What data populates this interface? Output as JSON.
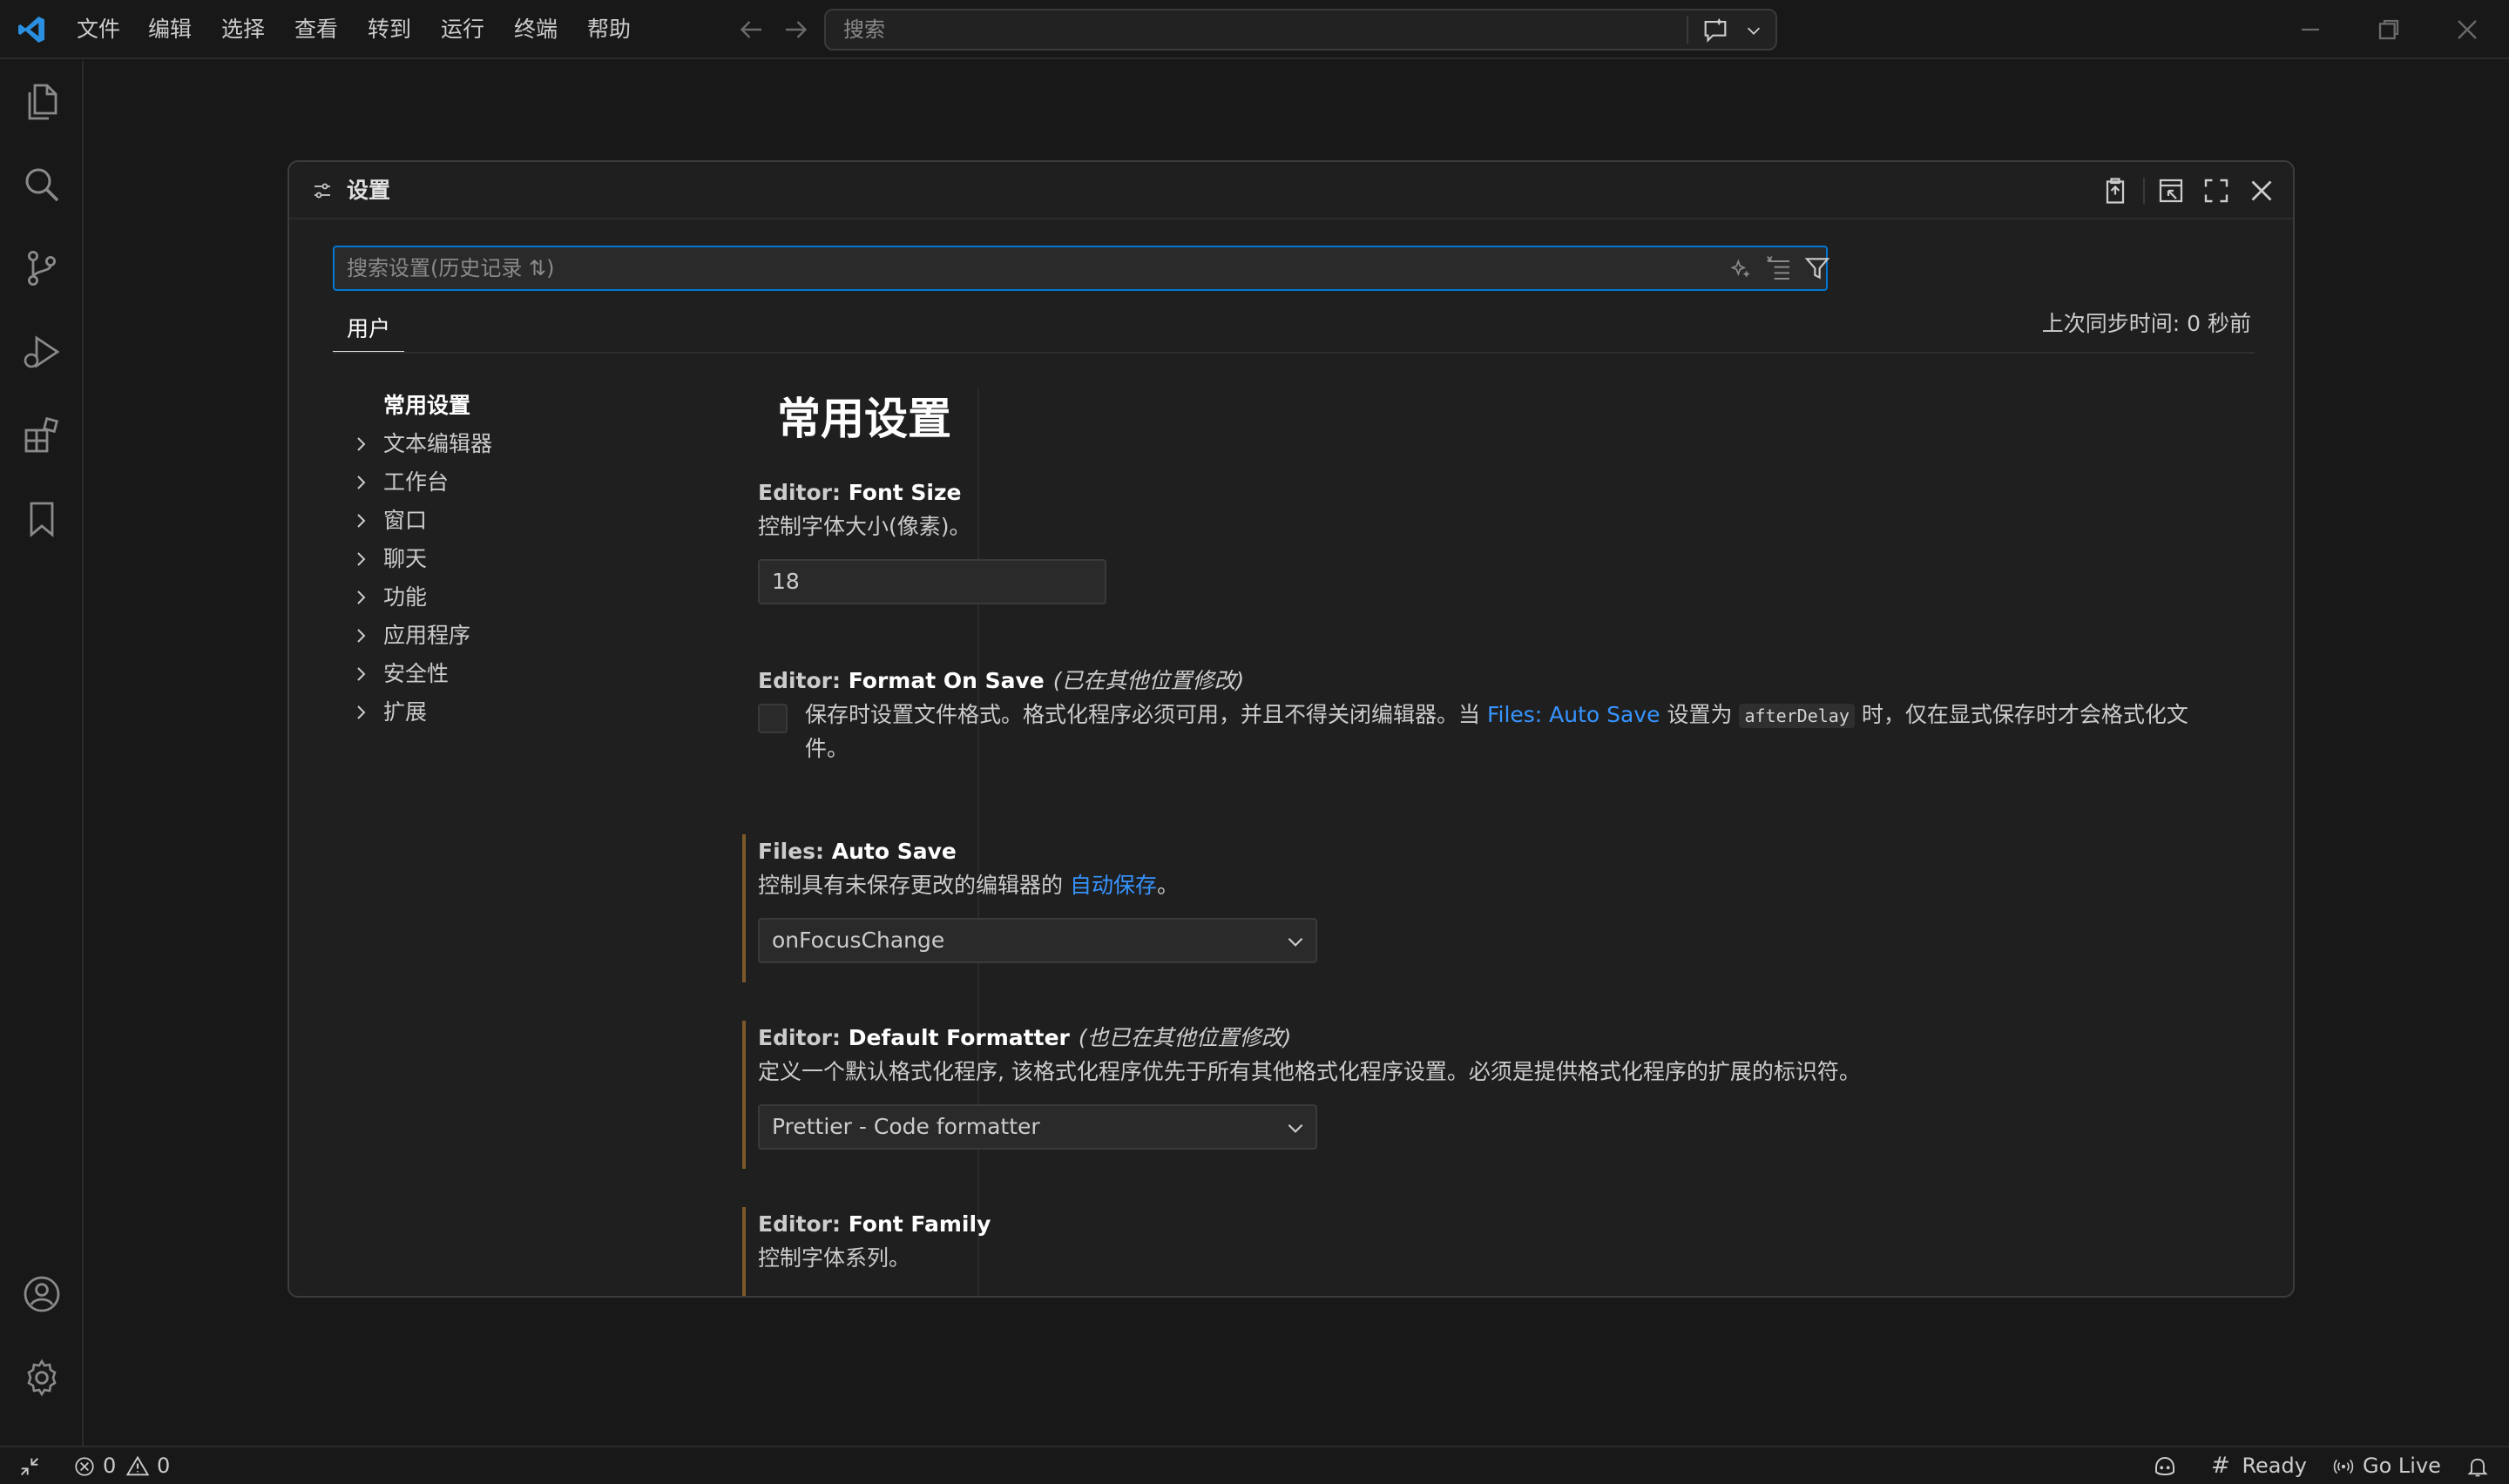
{
  "menu": [
    "文件",
    "编辑",
    "选择",
    "查看",
    "转到",
    "运行",
    "终端",
    "帮助"
  ],
  "command_center": {
    "placeholder": "搜索"
  },
  "settings": {
    "title": "设置",
    "search_placeholder": "搜索设置(历史记录 ⇅)",
    "tab_user": "用户",
    "sync_time": "上次同步时间: 0 秒前",
    "toc": [
      {
        "label": "常用设置",
        "active": true
      },
      {
        "label": "文本编辑器"
      },
      {
        "label": "工作台"
      },
      {
        "label": "窗口"
      },
      {
        "label": "聊天"
      },
      {
        "label": "功能"
      },
      {
        "label": "应用程序"
      },
      {
        "label": "安全性"
      },
      {
        "label": "扩展"
      }
    ],
    "section_title": "常用设置",
    "font_size": {
      "category": "Editor: ",
      "name": "Font Size",
      "desc": "控制字体大小(像素)。",
      "value": "18"
    },
    "format_on_save": {
      "category": "Editor: ",
      "name": "Format On Save",
      "modified": "(已在其他位置修改)",
      "desc_before": "保存时设置文件格式。格式化程序必须可用，并且不得关闭编辑器。当 ",
      "desc_link": "Files: Auto Save",
      "desc_mid": " 设置为 ",
      "desc_code": "afterDelay",
      "desc_after": " 时，仅在显式保存时才会格式化文件。",
      "checked": false
    },
    "auto_save": {
      "category": "Files: ",
      "name": "Auto Save",
      "desc_before": "控制具有未保存更改的编辑器的 ",
      "desc_link": "自动保存",
      "desc_after": "。",
      "value": "onFocusChange"
    },
    "default_formatter": {
      "category": "Editor: ",
      "name": "Default Formatter",
      "modified": "(也已在其他位置修改)",
      "desc": "定义一个默认格式化程序, 该格式化程序优先于所有其他格式化程序设置。必须是提供格式化程序的扩展的标识符。",
      "value": "Prettier - Code formatter"
    },
    "font_family": {
      "category": "Editor: ",
      "name": "Font Family",
      "desc": "控制字体系列。"
    }
  },
  "statusbar": {
    "errors": "0",
    "warnings": "0",
    "ready": "Ready",
    "go_live": "Go Live"
  },
  "colors": {
    "accent": "#0078d4",
    "link": "#3794ff",
    "modified_bar": "#7a5a2a"
  }
}
